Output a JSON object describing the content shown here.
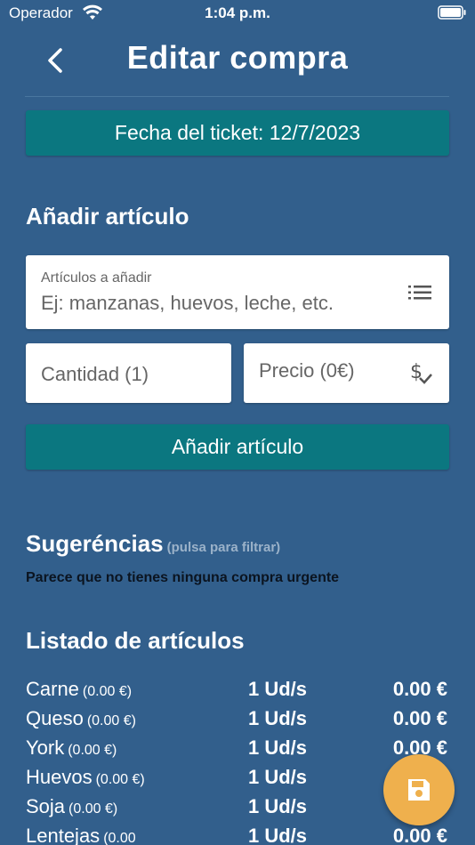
{
  "status_bar": {
    "carrier": "Operador",
    "time": "1:04 p.m."
  },
  "nav": {
    "title": "Editar compra"
  },
  "ticket": {
    "label": "Fecha del ticket: 12/7/2023"
  },
  "add_section": {
    "title": "Añadir artículo",
    "items_label": "Artículos a añadir",
    "items_placeholder": "Ej: manzanas, huevos, leche, etc.",
    "quantity_placeholder": "Cantidad (1)",
    "price_placeholder": "Precio (0€)",
    "add_button": "Añadir artículo"
  },
  "suggestions": {
    "title": "Sugeréncias",
    "hint": "(pulsa para filtrar)",
    "empty": "Parece que no tienes ninguna compra urgente"
  },
  "list": {
    "title": "Listado de artículos",
    "items": [
      {
        "name": "Carne",
        "unit_price": "(0.00 €)",
        "qty": "1 Ud/s",
        "total": "0.00 €"
      },
      {
        "name": "Queso",
        "unit_price": "(0.00 €)",
        "qty": "1 Ud/s",
        "total": "0.00 €"
      },
      {
        "name": "York",
        "unit_price": "(0.00 €)",
        "qty": "1 Ud/s",
        "total": "0.00 €"
      },
      {
        "name": "Huevos",
        "unit_price": "(0.00 €)",
        "qty": "1 Ud/s",
        "total": ""
      },
      {
        "name": "Soja",
        "unit_price": "(0.00 €)",
        "qty": "1 Ud/s",
        "total": ""
      },
      {
        "name": "Lentejas",
        "unit_price": "(0.00",
        "qty": "1 Ud/s",
        "total": "0.00 €"
      }
    ]
  },
  "colors": {
    "background": "#325f8c",
    "accent": "#0b7780",
    "fab": "#efb04d"
  },
  "icons": {
    "back": "chevron-left-icon",
    "list": "list-icon",
    "price": "dollar-check-icon",
    "save": "floppy-disk-icon"
  }
}
